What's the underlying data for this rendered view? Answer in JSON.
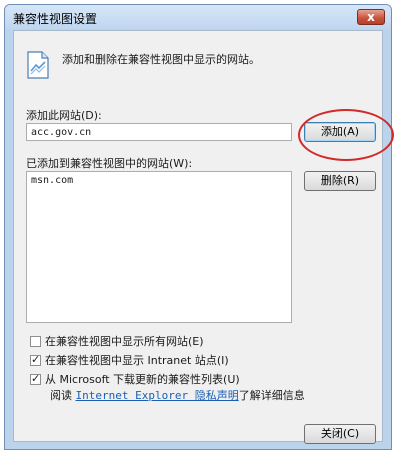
{
  "window": {
    "title": "兼容性视图设置",
    "close_glyph": "x"
  },
  "description": "添加和删除在兼容性视图中显示的网站。",
  "add_site": {
    "label": "添加此网站(D):",
    "value": "acc.gov.cn",
    "add_button": "添加(A)"
  },
  "added_sites": {
    "label": "已添加到兼容性视图中的网站(W):",
    "items": [
      "msn.com"
    ],
    "remove_button": "删除(R)"
  },
  "options": [
    {
      "label": "在兼容性视图中显示所有网站(E)",
      "checked": false
    },
    {
      "label": "在兼容性视图中显示 Intranet 站点(I)",
      "checked": true
    },
    {
      "label": "从 Microsoft 下载更新的兼容性列表(U)",
      "checked": true
    }
  ],
  "privacy": {
    "prefix": "阅读",
    "link": "Internet Explorer 隐私声明",
    "suffix": "了解详细信息"
  },
  "close_button": "关闭(C)",
  "colors": {
    "highlight_ring": "#d22a2a",
    "link": "#1a5fb4"
  },
  "icons": {
    "header": "compatibility-view-icon"
  }
}
